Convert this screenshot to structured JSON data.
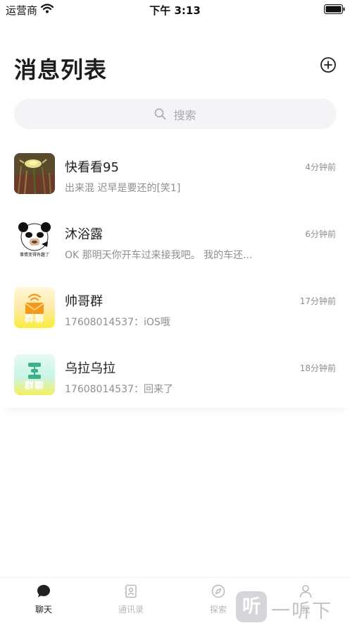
{
  "status_bar": {
    "carrier": "运营商",
    "time": "下午 3:13"
  },
  "header": {
    "title": "消息列表"
  },
  "search": {
    "placeholder": "搜索"
  },
  "chats": [
    {
      "name": "快看看95",
      "time": "4分钟前",
      "preview": "出来混 迟早是要还的[笑1]"
    },
    {
      "name": "沐浴露",
      "time": "6分钟前",
      "preview": "OK 那明天你开车过来接我吧。 我的车还..."
    },
    {
      "name": "帅哥群",
      "time": "17分钟前",
      "preview": "17608014537：iOS哦",
      "avatar_label": "群聊"
    },
    {
      "name": "乌拉乌拉",
      "time": "18分钟前",
      "preview": "17608014537：回来了",
      "avatar_label": "群聊"
    }
  ],
  "meme_caption": "事情变得有趣了",
  "tabs": [
    {
      "label": "聊天",
      "icon": "chat-bubble-icon",
      "active": true
    },
    {
      "label": "通讯录",
      "icon": "contacts-icon",
      "active": false
    },
    {
      "label": "探索",
      "icon": "compass-icon",
      "active": false
    },
    {
      "label": "我",
      "icon": "person-icon",
      "active": false
    }
  ],
  "watermark": {
    "logo": "听",
    "text": "一听下载"
  },
  "colors": {
    "text_primary": "#1f1f1f",
    "text_secondary": "#8e8e93",
    "search_bg": "#f4f4f6",
    "tab_inactive": "#b8b8bd"
  }
}
